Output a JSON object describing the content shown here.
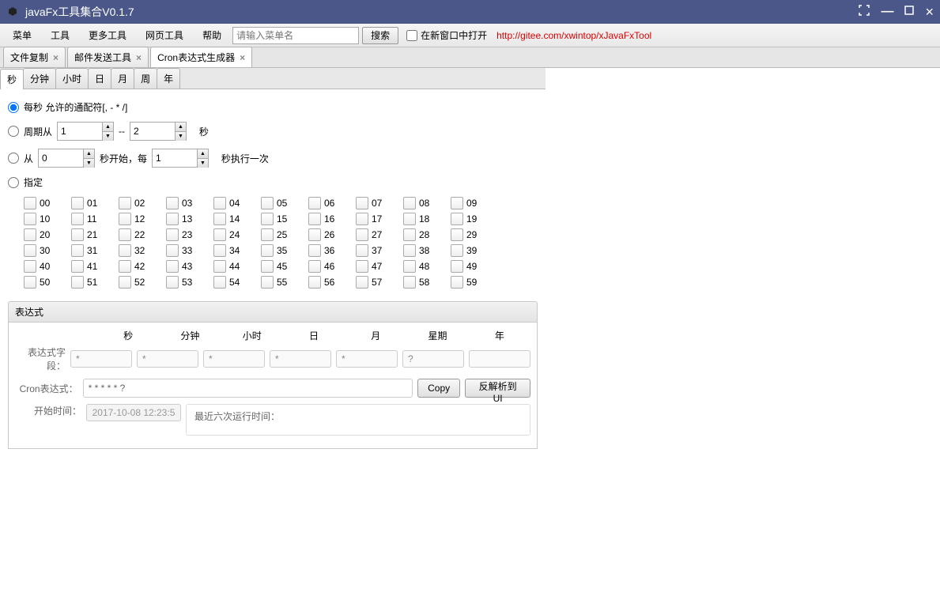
{
  "window": {
    "title": "javaFx工具集合V0.1.7"
  },
  "menubar": {
    "items": [
      "菜单",
      "工具",
      "更多工具",
      "网页工具",
      "帮助"
    ],
    "search_placeholder": "请输入菜单名",
    "search_btn": "搜索",
    "newwin_label": "在新窗口中打开",
    "link_text": "http://gitee.com/xwintop/xJavaFxTool"
  },
  "file_tabs": [
    {
      "label": "文件复制"
    },
    {
      "label": "邮件发送工具"
    },
    {
      "label": "Cron表达式生成器",
      "active": true
    }
  ],
  "sub_tabs": [
    "秒",
    "分钟",
    "小时",
    "日",
    "月",
    "周",
    "年"
  ],
  "cron": {
    "opt1": "每秒 允许的通配符[, - * /]",
    "opt2_pre": "周期从",
    "opt2_val1": "1",
    "opt2_mid": "--",
    "opt2_val2": "2",
    "opt2_unit": "秒",
    "opt3_pre": "从",
    "opt3_val1": "0",
    "opt3_mid": "秒开始，每",
    "opt3_val2": "1",
    "opt3_suf": "秒执行一次",
    "opt4": "指定"
  },
  "seconds_grid": [
    [
      "00",
      "01",
      "02",
      "03",
      "04",
      "05",
      "06",
      "07",
      "08",
      "09"
    ],
    [
      "10",
      "11",
      "12",
      "13",
      "14",
      "15",
      "16",
      "17",
      "18",
      "19"
    ],
    [
      "20",
      "21",
      "22",
      "23",
      "24",
      "25",
      "26",
      "27",
      "28",
      "29"
    ],
    [
      "30",
      "31",
      "32",
      "33",
      "34",
      "35",
      "36",
      "37",
      "38",
      "39"
    ],
    [
      "40",
      "41",
      "42",
      "43",
      "44",
      "45",
      "46",
      "47",
      "48",
      "49"
    ],
    [
      "50",
      "51",
      "52",
      "53",
      "54",
      "55",
      "56",
      "57",
      "58",
      "59"
    ]
  ],
  "expr": {
    "section_title": "表达式",
    "headers": [
      "秒",
      "分钟",
      "小时",
      "日",
      "月",
      "星期",
      "年"
    ],
    "fields_label": "表达式字段：",
    "fields": [
      "*",
      "*",
      "*",
      "*",
      "*",
      "?",
      ""
    ],
    "cron_label": "Cron表达式：",
    "cron_value": "* * * * * ?",
    "copy_btn": "Copy",
    "parse_btn": "反解析到UI",
    "start_label": "开始时间：",
    "start_value": "2017-10-08 12:23:5",
    "recent_label": "最近六次运行时间："
  }
}
